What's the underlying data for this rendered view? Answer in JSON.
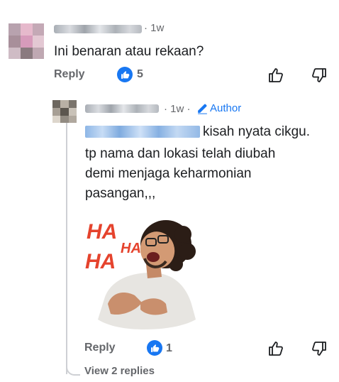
{
  "comment": {
    "time": "· 1w",
    "text": "Ini benaran atau rekaan?",
    "reply_label": "Reply",
    "like_count": "5"
  },
  "reply": {
    "time": "· 1w ·",
    "author_badge": "Author",
    "mention_suffix": "kisah nyata cikgu.",
    "lines": [
      "tp nama dan lokasi telah diubah",
      "demi menjaga keharmonian",
      "pasangan,,,"
    ],
    "sticker_text": [
      "HA",
      "HA",
      "HA"
    ],
    "reply_label": "Reply",
    "like_count": "1",
    "view_replies": "View 2 replies"
  },
  "icons": {
    "like_badge": "thumbs-up-icon",
    "like": "thumbs-up-outline-icon",
    "dislike": "thumbs-down-outline-icon",
    "author": "pencil-icon"
  },
  "colors": {
    "accent": "#1877f2",
    "muted": "#65676b",
    "text": "#1c1e21"
  }
}
